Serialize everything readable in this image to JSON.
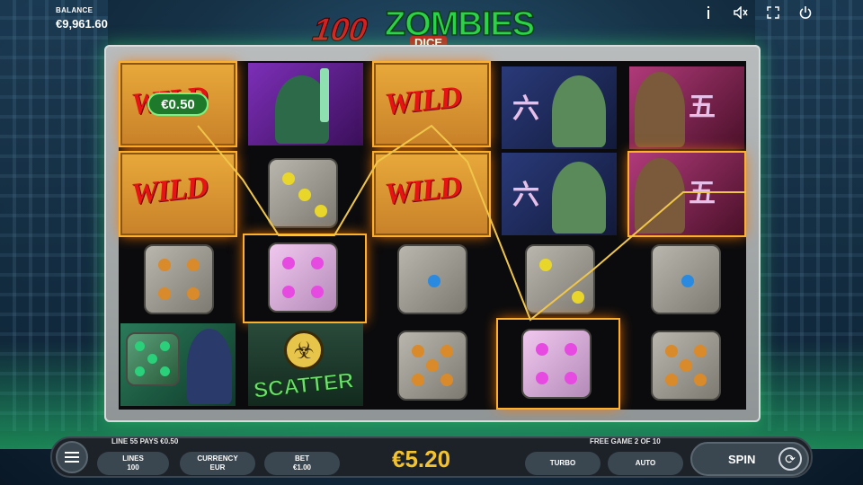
{
  "balance": {
    "label": "BALANCE",
    "value": "€9,961.60"
  },
  "logo": {
    "number": "100",
    "word": "ZOMBIES",
    "sub": "DICE"
  },
  "top_icons": [
    "info-icon",
    "sound-icon",
    "fullscreen-icon",
    "power-icon"
  ],
  "reels": {
    "win_badge": "€0.50",
    "wild_label": "WILD",
    "scatter_label": "SCATTER"
  },
  "footer": {
    "line_pays": "LINE 55 PAYS €0.50",
    "free_game": "FREE GAME 2 OF 10",
    "lines_label": "LINES",
    "lines_value": "100",
    "currency_label": "CURRENCY",
    "currency_value": "EUR",
    "bet_label": "BET",
    "bet_value": "€1.00",
    "total": "€5.20",
    "turbo": "TURBO",
    "auto": "AUTO",
    "spin": "SPIN"
  },
  "colors": {
    "gold": "#f2c230",
    "wild_red": "#e61414",
    "frame_glow": "#3cff78",
    "highlight": "#ffb02a"
  }
}
